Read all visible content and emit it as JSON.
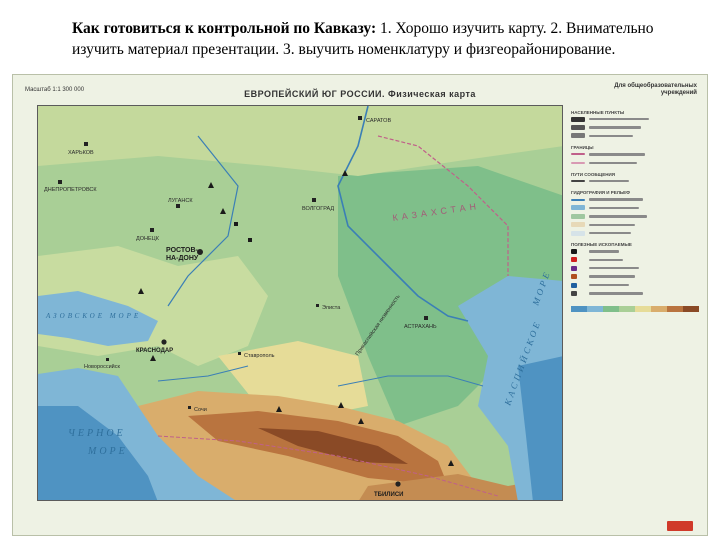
{
  "slide": {
    "heading_bold": "Как готовиться к контрольной по Кавказу:",
    "heading_rest": " 1. Хорошо изучить карту. 2. Внимательно изучить материал презентации. 3. выучить номенклатуру и физгеорайонирование."
  },
  "map": {
    "scale": "Масштаб 1:1 300 000",
    "title": "ЕВРОПЕЙСКИЙ ЮГ РОССИИ. Физическая карта",
    "audience": "Для общеобразовательных учреждений",
    "colors": {
      "sea": "#7fb6d6",
      "sea_deep": "#4f93c2",
      "lowland": "#a9cf96",
      "caspian_lowland": "#7fbf8a",
      "hills": "#e6dc98",
      "uplands": "#d9ad6c",
      "mountains": "#b9743f",
      "high_mountains": "#8a4a26"
    },
    "places": {
      "kharkov": "ХАРЬКОВ",
      "dnepropetrovsk": "ДНЕПРОПЕТРОВСК",
      "lugansk": "ЛУГАНСК",
      "donetsk": "ДОНЕЦК",
      "volgograd": "ВОЛГОГРАД",
      "saratov": "САРАТОВ",
      "rostov_line1": "РОСТОВ-",
      "rostov_line2": "НА-ДОНУ",
      "krasnodar": "КРАСНОДАР",
      "novorossiysk": "Новороссийск",
      "sochi": "Сочи",
      "stavropol": "Ставрополь",
      "elista": "Элиста",
      "astrakhan": "АСТРАХАНЬ",
      "tbilisi": "ТБИЛИСИ"
    },
    "water": {
      "azov": "АЗОВСКОЕ МОРЕ",
      "black_sea_1": "ЧЕРНОЕ",
      "black_sea_2": "МОРЕ",
      "caspian_1": "КАСПИЙСКОЕ",
      "caspian_2": "МОРЕ"
    },
    "regions": {
      "kazakhstan": "КАЗАХСТАН",
      "lowland": "Прикаспийская низменность"
    },
    "legend": {
      "settlements": "НАСЕЛЕННЫЕ ПУНКТЫ",
      "boundaries": "ГРАНИЦЫ",
      "routes": "ПУТИ СООБЩЕНИЯ",
      "hydrography": "ГИДРОГРАФИЯ И РЕЛЬЕФ",
      "minerals": "ПОЛЕЗНЫЕ ИСКОПАЕМЫЕ"
    }
  }
}
